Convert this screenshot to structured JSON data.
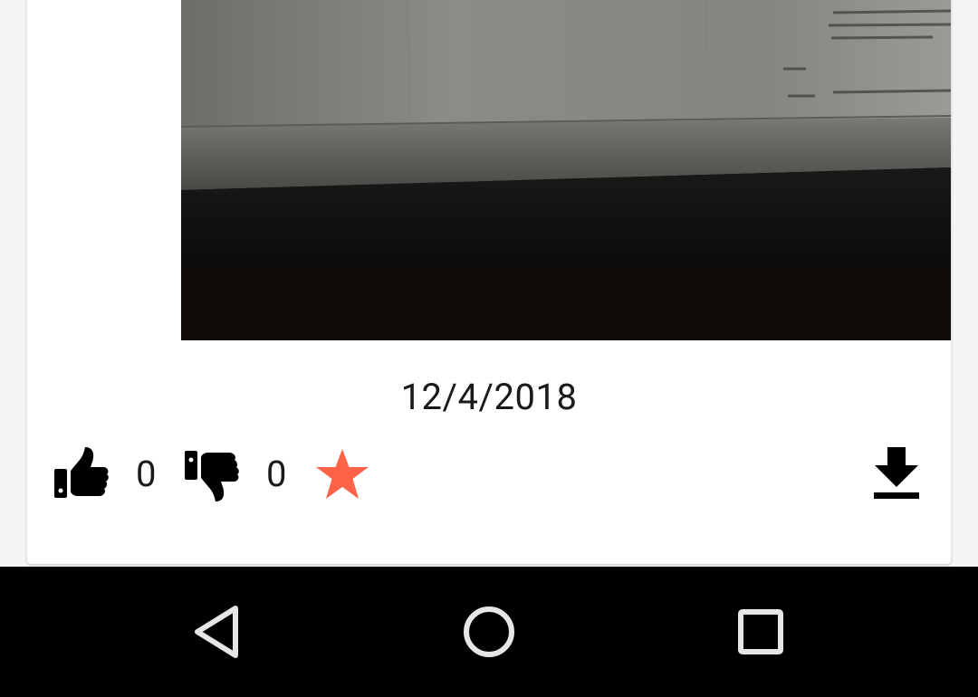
{
  "post": {
    "date": "12/4/2018",
    "likes": "0",
    "dislikes": "0"
  },
  "icons": {
    "like": "thumbs-up-icon",
    "dislike": "thumbs-down-icon",
    "favorite": "star-icon",
    "download": "download-icon"
  },
  "colors": {
    "favorite_star": "#ff6347",
    "icon": "#000000",
    "nav_background": "#000000",
    "nav_icon": "#e6e6e6"
  },
  "navbar": {
    "back": "back-triangle-icon",
    "home": "home-circle-icon",
    "recents": "recents-square-icon"
  }
}
